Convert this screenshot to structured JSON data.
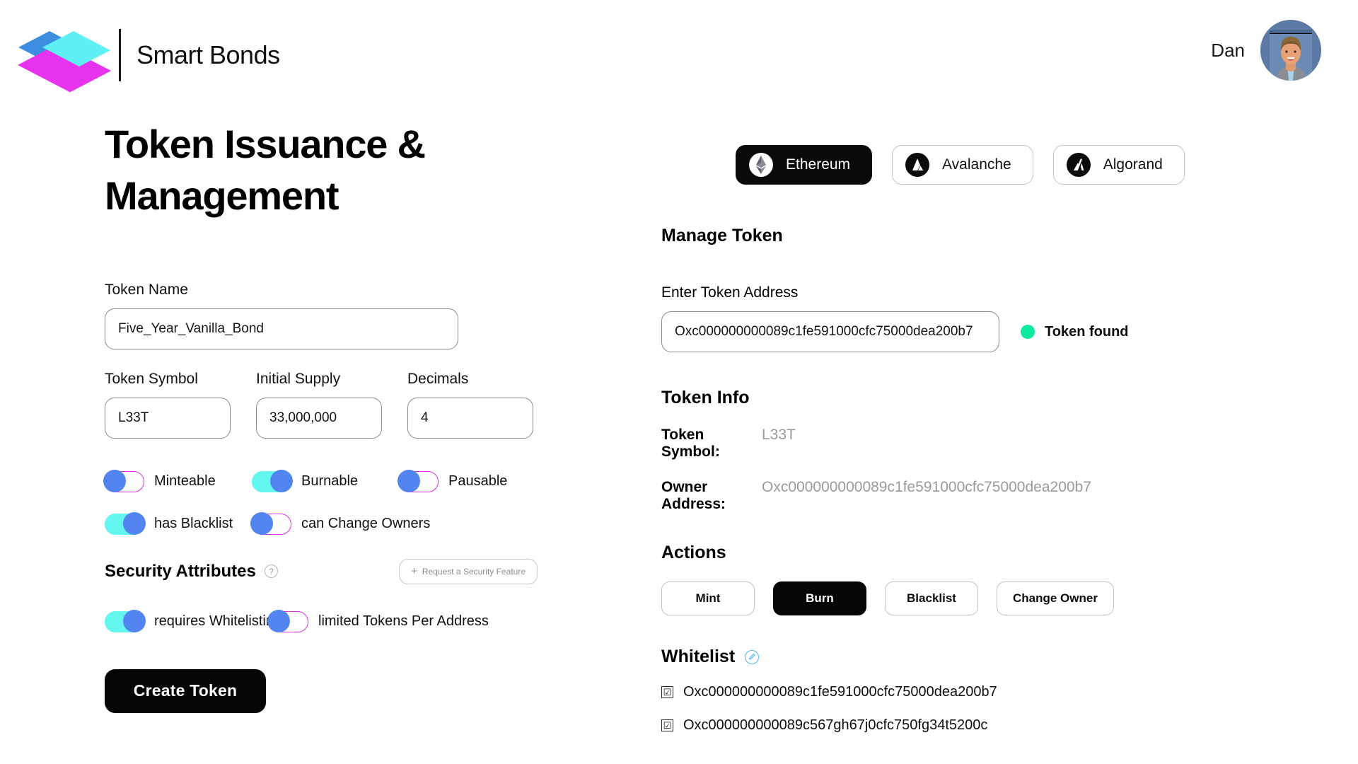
{
  "header": {
    "brand_name": "Smart Bonds",
    "user_name": "Dan"
  },
  "page": {
    "title": "Token Issuance & Management"
  },
  "form": {
    "token_name_label": "Token Name",
    "token_name_value": "Five_Year_Vanilla_Bond",
    "token_symbol_label": "Token Symbol",
    "token_symbol_value": "L33T",
    "initial_supply_label": "Initial Supply",
    "initial_supply_value": "33,000,000",
    "decimals_label": "Decimals",
    "decimals_value": "4",
    "toggles": [
      {
        "label": "Minteable",
        "state": "off"
      },
      {
        "label": "Burnable",
        "state": "on"
      },
      {
        "label": "Pausable",
        "state": "off"
      },
      {
        "label": "has Blacklist",
        "state": "on"
      },
      {
        "label": "can Change Owners",
        "state": "off"
      }
    ],
    "security": {
      "title": "Security Attributes",
      "help_icon": "question-mark-icon",
      "request_button_label": "Request a Security Feature",
      "request_button_icon": "plus-icon",
      "toggles": [
        {
          "label": "requires Whitelisting",
          "state": "on"
        },
        {
          "label": "limited Tokens Per Address",
          "state": "off"
        }
      ]
    },
    "create_button_label": "Create Token"
  },
  "networks": [
    {
      "label": "Ethereum",
      "icon": "ethereum-icon",
      "selected": true
    },
    {
      "label": "Avalanche",
      "icon": "avalanche-icon",
      "selected": false
    },
    {
      "label": "Algorand",
      "icon": "algorand-icon",
      "selected": false
    }
  ],
  "manage": {
    "section_title": "Manage Token",
    "address_label": "Enter Token Address",
    "address_value": "Oxc000000000089c1fe591000cfc75000dea200b7",
    "status_text": "Token found",
    "status_color": "#0cea9e"
  },
  "token_info": {
    "section_title": "Token Info",
    "rows": [
      {
        "key": "Token Symbol:",
        "value": "L33T"
      },
      {
        "key": "Owner Address:",
        "value": "Oxc000000000089c1fe591000cfc75000dea200b7"
      }
    ]
  },
  "actions": {
    "section_title": "Actions",
    "buttons": [
      {
        "label": "Mint",
        "selected": false
      },
      {
        "label": "Burn",
        "selected": true
      },
      {
        "label": "Blacklist",
        "selected": false
      },
      {
        "label": "Change Owner",
        "selected": false
      }
    ]
  },
  "whitelist": {
    "section_title": "Whitelist",
    "edit_icon": "pencil-edit-icon",
    "entries": [
      {
        "address": "Oxc000000000089c1fe591000cfc75000dea200b7",
        "checked": true
      },
      {
        "address": "Oxc000000000089c567gh67j0cfc750fg34t5200c",
        "checked": true
      }
    ],
    "check_glyph": "☑"
  },
  "colors": {
    "toggle_on": "#63f7f0",
    "toggle_knob": "#5285ef",
    "toggle_off_border": "#d92fe0",
    "accent_black": "#050505",
    "logo_blue": "#3d8ee0",
    "logo_cyan": "#5ef0f5",
    "logo_magenta": "#e733ed"
  }
}
